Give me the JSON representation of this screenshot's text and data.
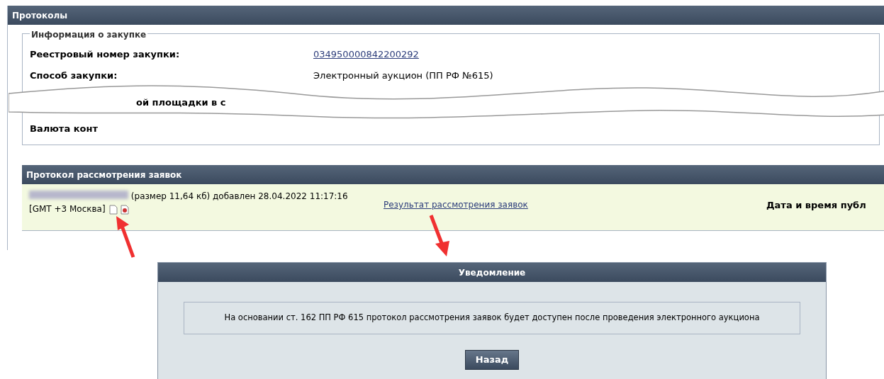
{
  "panel": {
    "title": "Протоколы"
  },
  "purchase_info": {
    "legend": "Информация о закупке",
    "rows": [
      {
        "kind": "link",
        "label": "Реестровый номер закупки:",
        "value": "034950000842200292"
      },
      {
        "kind": "text",
        "label": "Способ закупки:",
        "value": "Электронный аукцион (ПП РФ №615)"
      },
      {
        "kind": "torn",
        "label": "ой площадки в с"
      },
      {
        "kind": "text",
        "label": "Валюта конт"
      }
    ]
  },
  "protocol": {
    "title": "Протокол рассмотрения заявок",
    "file_info": "(размер 11,64 кб) добавлен 28.04.2022 11:17:16",
    "timezone": "[GMT +3 Москва]",
    "result_link": "Результат рассмотрения заявок",
    "publish_label": "Дата и время публ"
  },
  "dialog": {
    "title": "Уведомление",
    "message": "На основании ст. 162 ПП РФ 615 протокол рассмотрения заявок будет доступен после проведения электронного аукциона",
    "button": "Назад"
  }
}
